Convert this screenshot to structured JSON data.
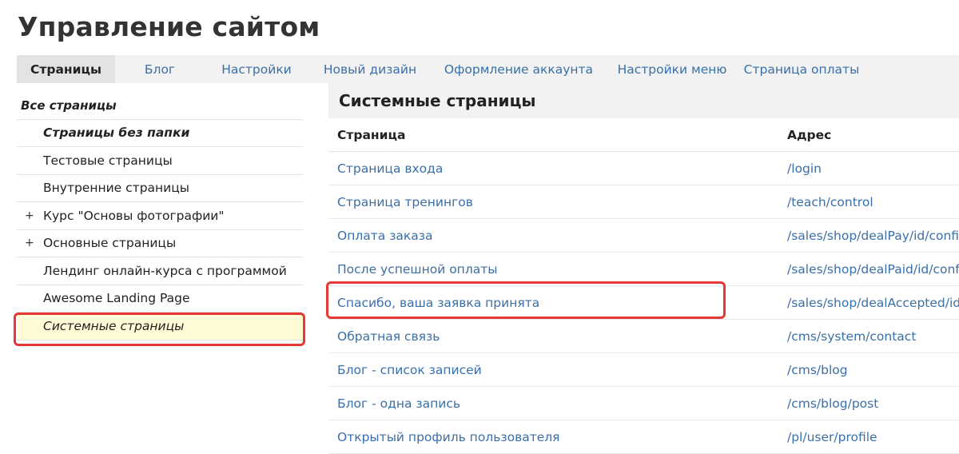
{
  "page": {
    "title": "Управление сайтом"
  },
  "tabs": [
    {
      "label": "Страницы",
      "active": true
    },
    {
      "label": "Блог",
      "active": false
    },
    {
      "label": "Настройки",
      "active": false
    },
    {
      "label": "Новый дизайн",
      "active": false
    },
    {
      "label": "Оформление аккаунта",
      "active": false
    },
    {
      "label": "Настройки меню",
      "active": false
    },
    {
      "label": "Страница оплаты",
      "active": false
    }
  ],
  "sidebar": {
    "items": [
      {
        "label": "Все страницы"
      },
      {
        "label": "Страницы без папки"
      },
      {
        "label": "Тестовые страницы"
      },
      {
        "label": "Внутренние страницы"
      },
      {
        "label": "Курс \"Основы фотографии\"",
        "expander": "+"
      },
      {
        "label": "Основные страницы",
        "expander": "+"
      },
      {
        "label": "Лендинг онлайн-курса с программой"
      },
      {
        "label": "Awesome Landing Page"
      },
      {
        "label": "Системные страницы",
        "selected": true
      }
    ]
  },
  "main": {
    "section_title": "Системные страницы",
    "columns": [
      "Страница",
      "Адрес"
    ],
    "rows": [
      {
        "page": "Страница входа",
        "address": "/login"
      },
      {
        "page": "Страница тренингов",
        "address": "/teach/control"
      },
      {
        "page": "Оплата заказа",
        "address": "/sales/shop/dealPay/id/config"
      },
      {
        "page": "После успешной оплаты",
        "address": "/sales/shop/dealPaid/id/config"
      },
      {
        "page": "Спасибо, ваша заявка принята",
        "address": "/sales/shop/dealAccepted/id"
      },
      {
        "page": "Обратная связь",
        "address": "/cms/system/contact"
      },
      {
        "page": "Блог - список записей",
        "address": "/cms/blog"
      },
      {
        "page": "Блог - одна запись",
        "address": "/cms/blog/post"
      },
      {
        "page": "Открытый профиль пользователя",
        "address": "/pl/user/profile"
      }
    ]
  },
  "colors": {
    "link": "#3a6fa8",
    "highlight": "#e53935",
    "selected_bg": "#fffbd6"
  }
}
